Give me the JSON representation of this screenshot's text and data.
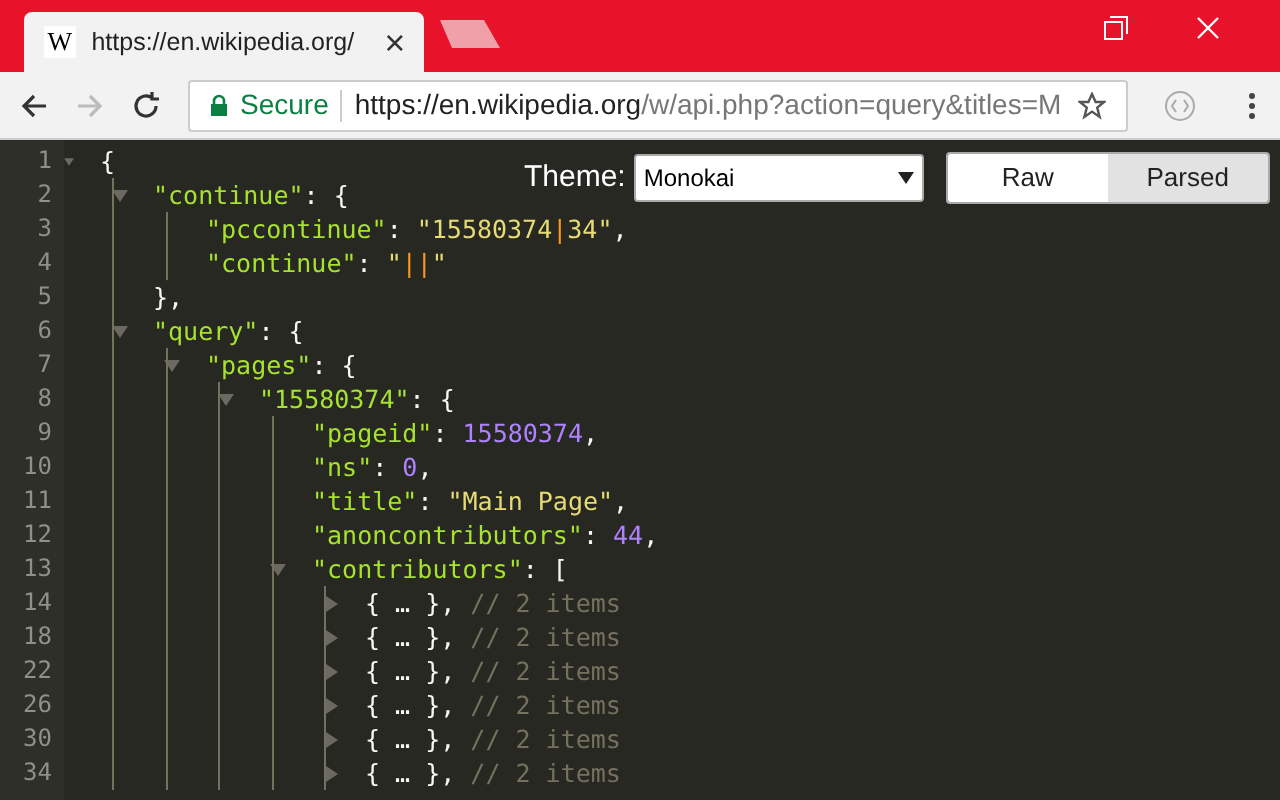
{
  "browser": {
    "tab": {
      "title": "https://en.wikipedia.org/",
      "favicon": "W"
    },
    "address": {
      "security": "Secure",
      "host": "https://en.wikipedia.org",
      "path": "/w/api.php?action=query&titles=M"
    }
  },
  "controls": {
    "theme_label": "Theme:",
    "theme_value": "Monokai",
    "views": [
      {
        "label": "Raw",
        "selected": false
      },
      {
        "label": "Parsed",
        "selected": true
      }
    ]
  },
  "lines": [
    {
      "number": "1",
      "expanded": true,
      "tokens": [
        {
          "kind": "punc",
          "text": "{"
        }
      ],
      "children": [
        {
          "number": "2",
          "expanded": true,
          "tokens": [
            {
              "kind": "key",
              "text": "\"continue\""
            },
            {
              "kind": "punc",
              "text": ": {"
            }
          ],
          "children": [
            {
              "number": "3",
              "tokens": [
                {
                  "kind": "key",
                  "text": "\"pccontinue\""
                },
                {
                  "kind": "punc",
                  "text": ": "
                },
                {
                  "kind": "str",
                  "text": "\"15580374"
                },
                {
                  "kind": "esc",
                  "text": "|"
                },
                {
                  "kind": "str",
                  "text": "34\""
                },
                {
                  "kind": "punc",
                  "text": ","
                }
              ]
            },
            {
              "number": "4",
              "tokens": [
                {
                  "kind": "key",
                  "text": "\"continue\""
                },
                {
                  "kind": "punc",
                  "text": ": "
                },
                {
                  "kind": "str",
                  "text": "\""
                },
                {
                  "kind": "esc",
                  "text": "||"
                },
                {
                  "kind": "str",
                  "text": "\""
                }
              ]
            }
          ]
        },
        {
          "number": "5",
          "tokens": [
            {
              "kind": "punc",
              "text": "},"
            }
          ]
        },
        {
          "number": "6",
          "expanded": true,
          "tokens": [
            {
              "kind": "key",
              "text": "\"query\""
            },
            {
              "kind": "punc",
              "text": ": {"
            }
          ],
          "children": [
            {
              "number": "7",
              "expanded": true,
              "tokens": [
                {
                  "kind": "key",
                  "text": "\"pages\""
                },
                {
                  "kind": "punc",
                  "text": ": {"
                }
              ],
              "children": [
                {
                  "number": "8",
                  "expanded": true,
                  "tokens": [
                    {
                      "kind": "key",
                      "text": "\"15580374\""
                    },
                    {
                      "kind": "punc",
                      "text": ": {"
                    }
                  ],
                  "children": [
                    {
                      "number": "9",
                      "tokens": [
                        {
                          "kind": "key",
                          "text": "\"pageid\""
                        },
                        {
                          "kind": "punc",
                          "text": ": "
                        },
                        {
                          "kind": "num",
                          "text": "15580374"
                        },
                        {
                          "kind": "punc",
                          "text": ","
                        }
                      ]
                    },
                    {
                      "number": "10",
                      "tokens": [
                        {
                          "kind": "key",
                          "text": "\"ns\""
                        },
                        {
                          "kind": "punc",
                          "text": ": "
                        },
                        {
                          "kind": "num",
                          "text": "0"
                        },
                        {
                          "kind": "punc",
                          "text": ","
                        }
                      ]
                    },
                    {
                      "number": "11",
                      "tokens": [
                        {
                          "kind": "key",
                          "text": "\"title\""
                        },
                        {
                          "kind": "punc",
                          "text": ": "
                        },
                        {
                          "kind": "str",
                          "text": "\"Main Page\""
                        },
                        {
                          "kind": "punc",
                          "text": ","
                        }
                      ]
                    },
                    {
                      "number": "12",
                      "tokens": [
                        {
                          "kind": "key",
                          "text": "\"anoncontributors\""
                        },
                        {
                          "kind": "punc",
                          "text": ": "
                        },
                        {
                          "kind": "num",
                          "text": "44"
                        },
                        {
                          "kind": "punc",
                          "text": ","
                        }
                      ]
                    },
                    {
                      "number": "13",
                      "expanded": true,
                      "tokens": [
                        {
                          "kind": "key",
                          "text": "\"contributors\""
                        },
                        {
                          "kind": "punc",
                          "text": ": ["
                        }
                      ],
                      "children": [
                        {
                          "number": "14",
                          "expanded": false,
                          "tokens": [
                            {
                              "kind": "punc",
                              "text": "{ … },"
                            },
                            {
                              "kind": "comment",
                              "text": " // 2 items"
                            }
                          ]
                        },
                        {
                          "number": "18",
                          "expanded": false,
                          "tokens": [
                            {
                              "kind": "punc",
                              "text": "{ … },"
                            },
                            {
                              "kind": "comment",
                              "text": " // 2 items"
                            }
                          ]
                        },
                        {
                          "number": "22",
                          "expanded": false,
                          "tokens": [
                            {
                              "kind": "punc",
                              "text": "{ … },"
                            },
                            {
                              "kind": "comment",
                              "text": " // 2 items"
                            }
                          ]
                        },
                        {
                          "number": "26",
                          "expanded": false,
                          "tokens": [
                            {
                              "kind": "punc",
                              "text": "{ … },"
                            },
                            {
                              "kind": "comment",
                              "text": " // 2 items"
                            }
                          ]
                        },
                        {
                          "number": "30",
                          "expanded": false,
                          "tokens": [
                            {
                              "kind": "punc",
                              "text": "{ … },"
                            },
                            {
                              "kind": "comment",
                              "text": " // 2 items"
                            }
                          ]
                        },
                        {
                          "number": "34",
                          "expanded": false,
                          "tokens": [
                            {
                              "kind": "punc",
                              "text": "{ … },"
                            },
                            {
                              "kind": "comment",
                              "text": " // 2 items"
                            }
                          ]
                        }
                      ]
                    }
                  ]
                }
              ]
            }
          ]
        }
      ]
    }
  ]
}
